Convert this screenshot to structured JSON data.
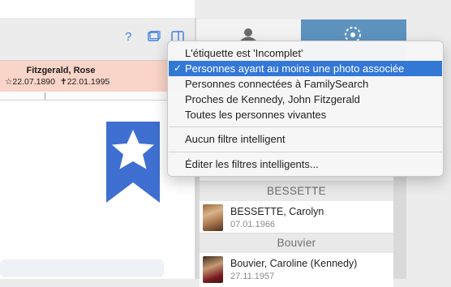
{
  "toolbar": {
    "help_label": "?",
    "colors": {
      "accent": "#3d7fe0"
    }
  },
  "person": {
    "name": "Fitzgerald, Rose",
    "birth": "22.07.1890",
    "death": "22.01.1995",
    "header_color": "#f9d4c8"
  },
  "panel": {
    "tab_active_color": "#5e93bf",
    "sections": [
      {
        "title": "BESSETTE",
        "rows": [
          {
            "name": "BESSETTE, Carolyn",
            "date": "07.01.1966"
          }
        ]
      },
      {
        "title": "Bouvier",
        "rows": [
          {
            "name": "Bouvier, Caroline (Kennedy)",
            "date": "27.11.1957"
          }
        ]
      }
    ]
  },
  "menu": {
    "selected_color": "#3478d6",
    "items": [
      {
        "label": "L'étiquette est 'Incomplet'"
      },
      {
        "label": "Personnes ayant au moins une photo associée",
        "checked": true
      },
      {
        "label": "Personnes connectées à FamilySearch"
      },
      {
        "label": "Proches de Kennedy, John Fitzgerald"
      },
      {
        "label": "Toutes les personnes vivantes"
      }
    ],
    "no_filter": "Aucun filtre intelligent",
    "edit": "Éditer les filtres intelligents..."
  }
}
